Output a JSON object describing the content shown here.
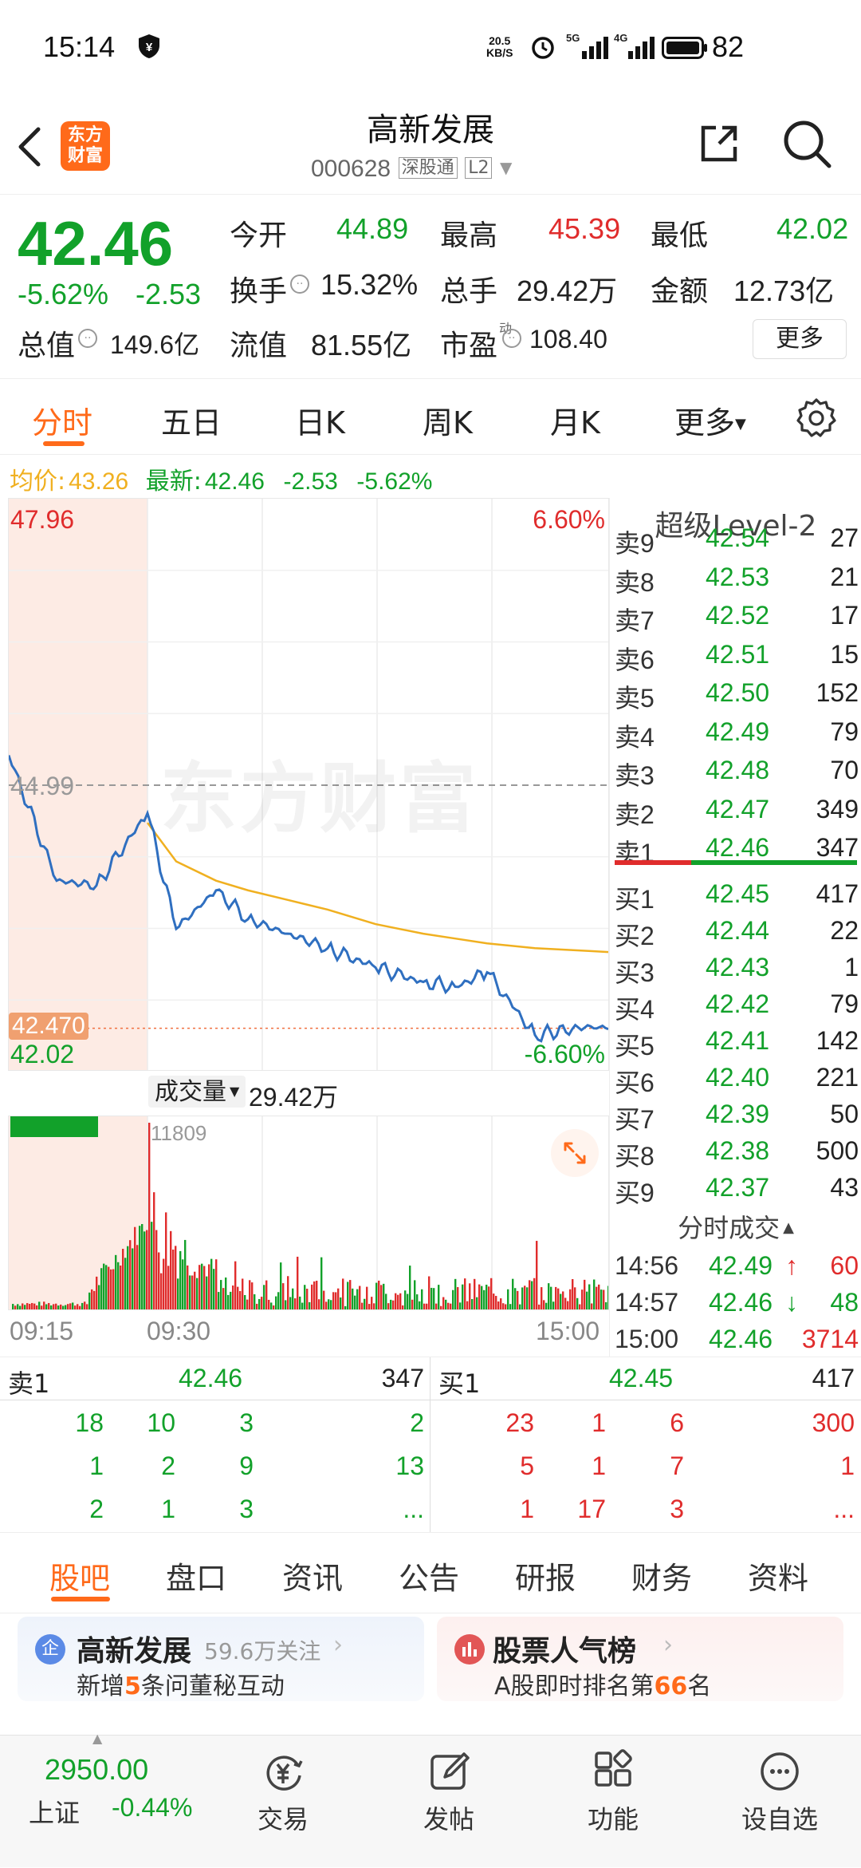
{
  "colors": {
    "up": "#e02c2c",
    "down": "#12a12a",
    "accent": "#ff6a1a",
    "avg": "#f0b020",
    "price": "#2f6fc0"
  },
  "status_bar": {
    "time": "15:14",
    "speed": "20.5",
    "speed_unit": "KB/S",
    "net1": "5G",
    "net2": "4G",
    "battery": "82"
  },
  "header": {
    "logo_line1": "东方",
    "logo_line2": "财富",
    "title": "高新发展",
    "code": "000628",
    "tag1": "深股通",
    "tag2": "L2"
  },
  "quote": {
    "price": "42.46",
    "change_pct": "-5.62%",
    "change": "-2.53",
    "row1": [
      {
        "label": "今开",
        "value": "44.89"
      },
      {
        "label": "最高",
        "value": "45.39"
      },
      {
        "label": "最低",
        "value": "42.02"
      }
    ],
    "row2": [
      {
        "label": "换手",
        "value": "15.32%"
      },
      {
        "label": "总手",
        "value": "29.42万"
      },
      {
        "label": "金额",
        "value": "12.73亿"
      }
    ],
    "row3": [
      {
        "label": "总值",
        "value": "149.6亿"
      },
      {
        "label": "流值",
        "value": "81.55亿"
      },
      {
        "label": "市盈",
        "sup": "动",
        "value": "108.40"
      }
    ],
    "more": "更多"
  },
  "period_tabs": [
    "分时",
    "五日",
    "日K",
    "周K",
    "月K",
    "更多"
  ],
  "chart_info": {
    "avg_label": "均价:",
    "avg_value": "43.26",
    "latest_label": "最新:",
    "latest_value": "42.46",
    "latest_change": "-2.53",
    "latest_pct": "-5.62%"
  },
  "chart_labels": {
    "top_price": "47.96",
    "top_pct": "6.60%",
    "prev_close": "44.99",
    "current": "42.470",
    "low_price": "42.02",
    "low_pct": "-6.60%",
    "watermark": "东方财富",
    "vol_label": "成交量",
    "vol_value": "29.42万",
    "vol_max": "11809",
    "t_start": "09:15",
    "t_mid": "09:30",
    "t_end": "15:00"
  },
  "chart_data": {
    "type": "line",
    "x": [
      "09:15",
      "09:20",
      "09:25",
      "09:30",
      "09:40",
      "09:50",
      "10:00",
      "10:15",
      "10:30",
      "11:00",
      "11:30",
      "13:30",
      "14:00",
      "14:30",
      "14:56",
      "15:00"
    ],
    "series": [
      {
        "values": [
          45.3,
          44.0,
          43.95,
          44.7,
          43.5,
          43.9,
          43.6,
          43.45,
          43.3,
          43.1,
          42.95,
          42.9,
          43.05,
          42.4,
          42.49,
          42.46
        ]
      },
      {
        "values": [
          45.3,
          44.0,
          43.95,
          44.6,
          44.2,
          44.0,
          43.9,
          43.8,
          43.7,
          43.55,
          43.45,
          43.4,
          43.35,
          43.3,
          43.27,
          43.26
        ]
      }
    ],
    "ylim": [
      42.02,
      47.96
    ],
    "volume": {
      "max": 11809
    }
  },
  "level2": {
    "title": "超级Level-2",
    "asks": [
      {
        "label": "卖9",
        "price": "42.54",
        "vol": "27"
      },
      {
        "label": "卖8",
        "price": "42.53",
        "vol": "21"
      },
      {
        "label": "卖7",
        "price": "42.52",
        "vol": "17"
      },
      {
        "label": "卖6",
        "price": "42.51",
        "vol": "15"
      },
      {
        "label": "卖5",
        "price": "42.50",
        "vol": "152"
      },
      {
        "label": "卖4",
        "price": "42.49",
        "vol": "79"
      },
      {
        "label": "卖3",
        "price": "42.48",
        "vol": "70"
      },
      {
        "label": "卖2",
        "price": "42.47",
        "vol": "349"
      },
      {
        "label": "卖1",
        "price": "42.46",
        "vol": "347"
      }
    ],
    "bids": [
      {
        "label": "买1",
        "price": "42.45",
        "vol": "417"
      },
      {
        "label": "买2",
        "price": "42.44",
        "vol": "22"
      },
      {
        "label": "买3",
        "price": "42.43",
        "vol": "1"
      },
      {
        "label": "买4",
        "price": "42.42",
        "vol": "79"
      },
      {
        "label": "买5",
        "price": "42.41",
        "vol": "142"
      },
      {
        "label": "买6",
        "price": "42.40",
        "vol": "221"
      },
      {
        "label": "买7",
        "price": "42.39",
        "vol": "50"
      },
      {
        "label": "买8",
        "price": "42.38",
        "vol": "500"
      },
      {
        "label": "买9",
        "price": "42.37",
        "vol": "43"
      }
    ],
    "trades_title": "分时成交",
    "trades": [
      {
        "time": "14:56",
        "price": "42.49",
        "arrow": "↑",
        "vol": "60"
      },
      {
        "time": "14:57",
        "price": "42.46",
        "arrow": "↓",
        "vol": "48"
      },
      {
        "time": "15:00",
        "price": "42.46",
        "arrow": "",
        "vol": "3714"
      }
    ]
  },
  "queue": {
    "sell_label": "卖1",
    "sell_price": "42.46",
    "sell_vol": "347",
    "buy_label": "买1",
    "buy_price": "42.45",
    "buy_vol": "417",
    "sell_rows": [
      [
        "18",
        "10",
        "3",
        "2"
      ],
      [
        "1",
        "2",
        "9",
        "13"
      ],
      [
        "2",
        "1",
        "3",
        "..."
      ]
    ],
    "buy_rows": [
      [
        "23",
        "1",
        "6",
        "300"
      ],
      [
        "5",
        "1",
        "7",
        "1"
      ],
      [
        "1",
        "17",
        "3",
        "..."
      ]
    ]
  },
  "bottom_tabs": [
    "股吧",
    "盘口",
    "资讯",
    "公告",
    "研报",
    "财务",
    "资料"
  ],
  "cards": [
    {
      "icon": "企",
      "title": "高新发展",
      "sub_title": "59.6万关注",
      "pre": "新增",
      "num": "5",
      "post": "条问董秘互动"
    },
    {
      "title": "股票人气榜",
      "pre": "A股即时排名第",
      "num": "66",
      "post": "名"
    }
  ],
  "bottom_nav": {
    "index_value": "2950.00",
    "index_name": "上证",
    "index_change": "-0.44%",
    "items": [
      "交易",
      "发帖",
      "功能",
      "设自选"
    ]
  }
}
